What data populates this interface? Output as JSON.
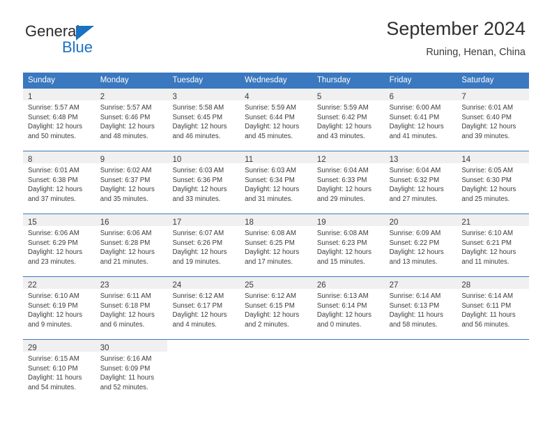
{
  "brand": {
    "name_top": "General",
    "name_bottom": "Blue",
    "triangle_color": "#1b72c0"
  },
  "header": {
    "title": "September 2024",
    "subtitle": "Runing, Henan, China"
  },
  "calendar": {
    "accent_color": "#3a78bf",
    "day_band_color": "#f0f0f0",
    "day_names": [
      "Sunday",
      "Monday",
      "Tuesday",
      "Wednesday",
      "Thursday",
      "Friday",
      "Saturday"
    ],
    "weeks": [
      [
        {
          "day": "1",
          "lines": [
            "Sunrise: 5:57 AM",
            "Sunset: 6:48 PM",
            "Daylight: 12 hours",
            "and 50 minutes."
          ]
        },
        {
          "day": "2",
          "lines": [
            "Sunrise: 5:57 AM",
            "Sunset: 6:46 PM",
            "Daylight: 12 hours",
            "and 48 minutes."
          ]
        },
        {
          "day": "3",
          "lines": [
            "Sunrise: 5:58 AM",
            "Sunset: 6:45 PM",
            "Daylight: 12 hours",
            "and 46 minutes."
          ]
        },
        {
          "day": "4",
          "lines": [
            "Sunrise: 5:59 AM",
            "Sunset: 6:44 PM",
            "Daylight: 12 hours",
            "and 45 minutes."
          ]
        },
        {
          "day": "5",
          "lines": [
            "Sunrise: 5:59 AM",
            "Sunset: 6:42 PM",
            "Daylight: 12 hours",
            "and 43 minutes."
          ]
        },
        {
          "day": "6",
          "lines": [
            "Sunrise: 6:00 AM",
            "Sunset: 6:41 PM",
            "Daylight: 12 hours",
            "and 41 minutes."
          ]
        },
        {
          "day": "7",
          "lines": [
            "Sunrise: 6:01 AM",
            "Sunset: 6:40 PM",
            "Daylight: 12 hours",
            "and 39 minutes."
          ]
        }
      ],
      [
        {
          "day": "8",
          "lines": [
            "Sunrise: 6:01 AM",
            "Sunset: 6:38 PM",
            "Daylight: 12 hours",
            "and 37 minutes."
          ]
        },
        {
          "day": "9",
          "lines": [
            "Sunrise: 6:02 AM",
            "Sunset: 6:37 PM",
            "Daylight: 12 hours",
            "and 35 minutes."
          ]
        },
        {
          "day": "10",
          "lines": [
            "Sunrise: 6:03 AM",
            "Sunset: 6:36 PM",
            "Daylight: 12 hours",
            "and 33 minutes."
          ]
        },
        {
          "day": "11",
          "lines": [
            "Sunrise: 6:03 AM",
            "Sunset: 6:34 PM",
            "Daylight: 12 hours",
            "and 31 minutes."
          ]
        },
        {
          "day": "12",
          "lines": [
            "Sunrise: 6:04 AM",
            "Sunset: 6:33 PM",
            "Daylight: 12 hours",
            "and 29 minutes."
          ]
        },
        {
          "day": "13",
          "lines": [
            "Sunrise: 6:04 AM",
            "Sunset: 6:32 PM",
            "Daylight: 12 hours",
            "and 27 minutes."
          ]
        },
        {
          "day": "14",
          "lines": [
            "Sunrise: 6:05 AM",
            "Sunset: 6:30 PM",
            "Daylight: 12 hours",
            "and 25 minutes."
          ]
        }
      ],
      [
        {
          "day": "15",
          "lines": [
            "Sunrise: 6:06 AM",
            "Sunset: 6:29 PM",
            "Daylight: 12 hours",
            "and 23 minutes."
          ]
        },
        {
          "day": "16",
          "lines": [
            "Sunrise: 6:06 AM",
            "Sunset: 6:28 PM",
            "Daylight: 12 hours",
            "and 21 minutes."
          ]
        },
        {
          "day": "17",
          "lines": [
            "Sunrise: 6:07 AM",
            "Sunset: 6:26 PM",
            "Daylight: 12 hours",
            "and 19 minutes."
          ]
        },
        {
          "day": "18",
          "lines": [
            "Sunrise: 6:08 AM",
            "Sunset: 6:25 PM",
            "Daylight: 12 hours",
            "and 17 minutes."
          ]
        },
        {
          "day": "19",
          "lines": [
            "Sunrise: 6:08 AM",
            "Sunset: 6:23 PM",
            "Daylight: 12 hours",
            "and 15 minutes."
          ]
        },
        {
          "day": "20",
          "lines": [
            "Sunrise: 6:09 AM",
            "Sunset: 6:22 PM",
            "Daylight: 12 hours",
            "and 13 minutes."
          ]
        },
        {
          "day": "21",
          "lines": [
            "Sunrise: 6:10 AM",
            "Sunset: 6:21 PM",
            "Daylight: 12 hours",
            "and 11 minutes."
          ]
        }
      ],
      [
        {
          "day": "22",
          "lines": [
            "Sunrise: 6:10 AM",
            "Sunset: 6:19 PM",
            "Daylight: 12 hours",
            "and 9 minutes."
          ]
        },
        {
          "day": "23",
          "lines": [
            "Sunrise: 6:11 AM",
            "Sunset: 6:18 PM",
            "Daylight: 12 hours",
            "and 6 minutes."
          ]
        },
        {
          "day": "24",
          "lines": [
            "Sunrise: 6:12 AM",
            "Sunset: 6:17 PM",
            "Daylight: 12 hours",
            "and 4 minutes."
          ]
        },
        {
          "day": "25",
          "lines": [
            "Sunrise: 6:12 AM",
            "Sunset: 6:15 PM",
            "Daylight: 12 hours",
            "and 2 minutes."
          ]
        },
        {
          "day": "26",
          "lines": [
            "Sunrise: 6:13 AM",
            "Sunset: 6:14 PM",
            "Daylight: 12 hours",
            "and 0 minutes."
          ]
        },
        {
          "day": "27",
          "lines": [
            "Sunrise: 6:14 AM",
            "Sunset: 6:13 PM",
            "Daylight: 11 hours",
            "and 58 minutes."
          ]
        },
        {
          "day": "28",
          "lines": [
            "Sunrise: 6:14 AM",
            "Sunset: 6:11 PM",
            "Daylight: 11 hours",
            "and 56 minutes."
          ]
        }
      ],
      [
        {
          "day": "29",
          "lines": [
            "Sunrise: 6:15 AM",
            "Sunset: 6:10 PM",
            "Daylight: 11 hours",
            "and 54 minutes."
          ]
        },
        {
          "day": "30",
          "lines": [
            "Sunrise: 6:16 AM",
            "Sunset: 6:09 PM",
            "Daylight: 11 hours",
            "and 52 minutes."
          ]
        },
        {
          "day": "",
          "lines": []
        },
        {
          "day": "",
          "lines": []
        },
        {
          "day": "",
          "lines": []
        },
        {
          "day": "",
          "lines": []
        },
        {
          "day": "",
          "lines": []
        }
      ]
    ]
  }
}
